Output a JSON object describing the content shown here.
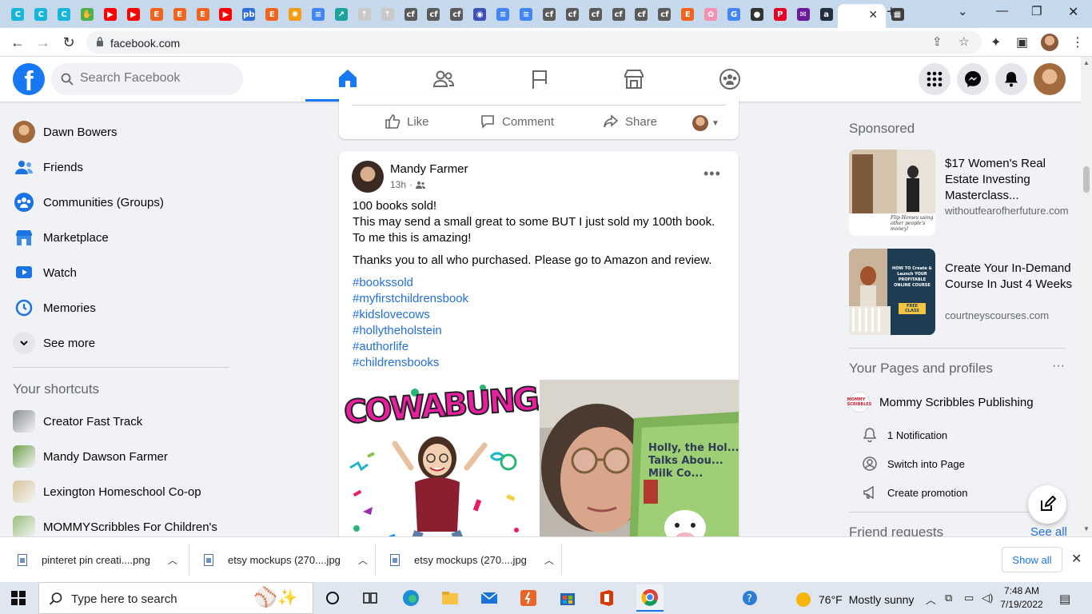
{
  "browser": {
    "tab_favicons": [
      {
        "icon": "canva-icon",
        "color": "#18b6d8",
        "glyph": "C"
      },
      {
        "icon": "canva-icon",
        "color": "#18b6d8",
        "glyph": "C"
      },
      {
        "icon": "canva-icon",
        "color": "#18b6d8",
        "glyph": "C"
      },
      {
        "icon": "hand-icon",
        "color": "#4caf50",
        "glyph": "✋"
      },
      {
        "icon": "youtube-icon",
        "color": "#ff0000",
        "glyph": "▶"
      },
      {
        "icon": "youtube-icon",
        "color": "#ff0000",
        "glyph": "▶"
      },
      {
        "icon": "etsy-icon",
        "color": "#f1641e",
        "glyph": "E"
      },
      {
        "icon": "etsy-icon",
        "color": "#f1641e",
        "glyph": "E"
      },
      {
        "icon": "etsy-icon",
        "color": "#f1641e",
        "glyph": "E"
      },
      {
        "icon": "youtube-icon",
        "color": "#ff0000",
        "glyph": "▶"
      },
      {
        "icon": "pb-icon",
        "color": "#2e6fd8",
        "glyph": "pb"
      },
      {
        "icon": "etsy-icon",
        "color": "#f1641e",
        "glyph": "E"
      },
      {
        "icon": "orange-icon",
        "color": "#f39c12",
        "glyph": "✺"
      },
      {
        "icon": "docs-icon",
        "color": "#4285f4",
        "glyph": "≡"
      },
      {
        "icon": "teal-icon",
        "color": "#1ba39c",
        "glyph": "↗"
      },
      {
        "icon": "leaf-icon",
        "color": "#c9c9c9",
        "glyph": "⇡"
      },
      {
        "icon": "leaf-icon",
        "color": "#c9c9c9",
        "glyph": "⇡"
      },
      {
        "icon": "cf-icon",
        "color": "#5a5a5a",
        "glyph": "cf"
      },
      {
        "icon": "cf-icon",
        "color": "#5a5a5a",
        "glyph": "cf"
      },
      {
        "icon": "cf-icon",
        "color": "#5a5a5a",
        "glyph": "cf"
      },
      {
        "icon": "globe-icon",
        "color": "#3f51b5",
        "glyph": "◉"
      },
      {
        "icon": "docs-icon",
        "color": "#4285f4",
        "glyph": "≡"
      },
      {
        "icon": "docs-icon",
        "color": "#4285f4",
        "glyph": "≡"
      },
      {
        "icon": "cf-icon",
        "color": "#5a5a5a",
        "glyph": "cf"
      },
      {
        "icon": "cf-icon",
        "color": "#5a5a5a",
        "glyph": "cf"
      },
      {
        "icon": "cf-icon",
        "color": "#5a5a5a",
        "glyph": "cf"
      },
      {
        "icon": "cf-icon",
        "color": "#5a5a5a",
        "glyph": "cf"
      },
      {
        "icon": "cf-icon",
        "color": "#5a5a5a",
        "glyph": "cf"
      },
      {
        "icon": "cf-icon",
        "color": "#5a5a5a",
        "glyph": "cf"
      },
      {
        "icon": "etsy-icon",
        "color": "#f1641e",
        "glyph": "E"
      },
      {
        "icon": "flower-icon",
        "color": "#f48fb1",
        "glyph": "✿"
      },
      {
        "icon": "google-icon",
        "color": "#4285f4",
        "glyph": "G"
      },
      {
        "icon": "github-icon",
        "color": "#333333",
        "glyph": "●"
      },
      {
        "icon": "pinterest-icon",
        "color": "#e60023",
        "glyph": "P"
      },
      {
        "icon": "mail-icon",
        "color": "#6a1b9a",
        "glyph": "✉"
      },
      {
        "icon": "amazon-icon",
        "color": "#232f3e",
        "glyph": "a"
      }
    ],
    "url": "facebook.com"
  },
  "facebook": {
    "search_placeholder": "Search Facebook",
    "left_nav": [
      {
        "label": "Dawn Bowers",
        "icon": "profile-avatar",
        "color": "#a36a3e"
      },
      {
        "label": "Friends",
        "icon": "friends-icon",
        "color": "#1b74e4"
      },
      {
        "label": "Communities (Groups)",
        "icon": "groups-icon",
        "color": "#1b74e4"
      },
      {
        "label": "Marketplace",
        "icon": "marketplace-icon",
        "color": "#1b74e4"
      },
      {
        "label": "Watch",
        "icon": "watch-icon",
        "color": "#1b74e4"
      },
      {
        "label": "Memories",
        "icon": "memories-icon",
        "color": "#1b74e4"
      },
      {
        "label": "See more",
        "icon": "chevron-down-icon",
        "color": "#e4e6eb"
      }
    ],
    "shortcuts_title": "Your shortcuts",
    "shortcuts": [
      {
        "label": "Creator Fast Track",
        "color": "#8b8f94"
      },
      {
        "label": "Mandy Dawson Farmer",
        "color": "#6da04b"
      },
      {
        "label": "Lexington Homeschool Co-op",
        "color": "#d6c59b"
      },
      {
        "label": "MOMMYScribbles For Children's",
        "color": "#9bbf7e"
      }
    ],
    "prev_post_actions": {
      "like": "Like",
      "comment": "Comment",
      "share": "Share"
    },
    "post": {
      "author": "Mandy Farmer",
      "time": "13h",
      "line1": "100 books sold!",
      "line2": "This may send a small great to some BUT I just sold my 100th book. To me this is amazing!",
      "line3": "Thanks you to all who purchased. Please go to Amazon and review.",
      "hashtags": [
        "#bookssold",
        "#myfirstchildrensbook",
        "#kidslovecows",
        "#hollytheholstein",
        "#authorlife",
        "#childrensbooks"
      ],
      "image_left_text": "COWABUNGA",
      "image_right_text": "Holly, the Hol... Talks Abou... Milk Co..."
    },
    "sponsored": {
      "title": "Sponsored",
      "ads": [
        {
          "title": "$17 Women's Real Estate Investing Masterclass...",
          "domain": "withoutfearofherfuture.com",
          "thumb_text": "Flip Homes using other people's money!"
        },
        {
          "title": "Create Your In-Demand Course In Just 4 Weeks",
          "domain": "courtneyscourses.com",
          "thumb_text": "HOW TO Create & Launch YOUR PROFITABLE ONLINE COURSE",
          "thumb_badge": "FREE CLASS"
        }
      ]
    },
    "pages": {
      "title": "Your Pages and profiles",
      "more": "···",
      "page_name": "Mommy Scribbles Publishing",
      "page_logo_text": "MOMMY SCRIBBLES",
      "actions": [
        "1 Notification",
        "Switch into Page",
        "Create promotion"
      ]
    },
    "friend_requests": {
      "title": "Friend requests",
      "see_all": "See all"
    },
    "accent_color": "#1877f2"
  },
  "downloads": {
    "items": [
      "pinteret pin creati....png",
      "etsy mockups (270....jpg",
      "etsy mockups (270....jpg"
    ],
    "show_all": "Show all"
  },
  "taskbar": {
    "search_placeholder": "Type here to search",
    "weather_temp": "76°F",
    "weather_text": "Mostly sunny",
    "time": "7:48 AM",
    "date": "7/19/2022"
  }
}
